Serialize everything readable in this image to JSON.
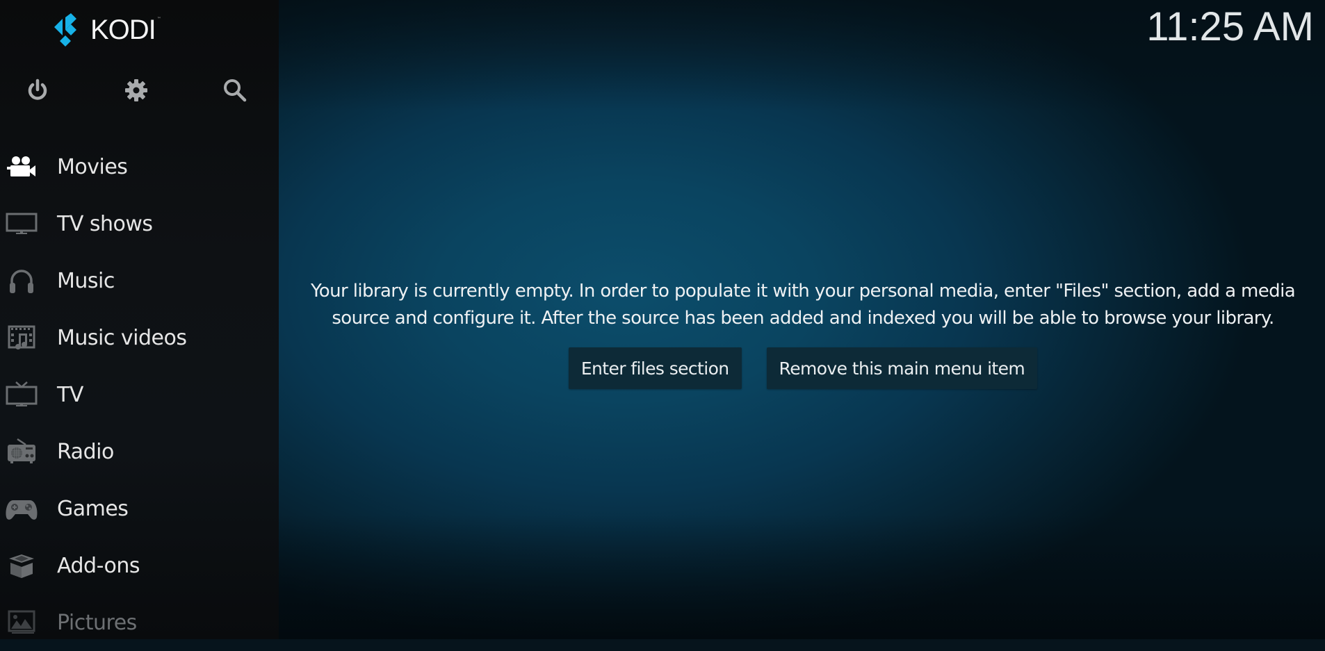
{
  "app": {
    "name": "KODI"
  },
  "header": {
    "clock": "11:25 AM"
  },
  "sidebar": {
    "top_icons": [
      {
        "name": "power-icon",
        "label": "Power"
      },
      {
        "name": "settings-gear-icon",
        "label": "Settings"
      },
      {
        "name": "search-icon",
        "label": "Search"
      }
    ],
    "items": [
      {
        "label": "Movies",
        "icon": "movie-camera-icon",
        "active": true
      },
      {
        "label": "TV shows",
        "icon": "monitor-icon"
      },
      {
        "label": "Music",
        "icon": "headphones-icon"
      },
      {
        "label": "Music videos",
        "icon": "music-video-icon"
      },
      {
        "label": "TV",
        "icon": "tv-antenna-icon"
      },
      {
        "label": "Radio",
        "icon": "radio-icon"
      },
      {
        "label": "Games",
        "icon": "gamepad-icon"
      },
      {
        "label": "Add-ons",
        "icon": "addons-box-icon"
      },
      {
        "label": "Pictures",
        "icon": "pictures-icon"
      }
    ]
  },
  "main": {
    "message": "Your library is currently empty. In order to populate it with your personal media, enter \"Files\" section, add a media source and configure it. After the source has been added and indexed you will be able to browse your library.",
    "buttons": {
      "enter_files": "Enter files section",
      "remove_item": "Remove this main menu item"
    }
  },
  "colors": {
    "brand_blue": "#17b2e8",
    "sidebar_bg": "#0e1114",
    "main_bg_center": "#0b4560",
    "button_bg": "#0d2a37",
    "icon_gray": "#6b6e71",
    "text_primary": "#e8e8e8"
  }
}
